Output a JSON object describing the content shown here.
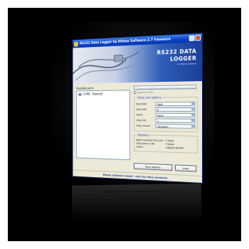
{
  "window": {
    "title": "RS232 Data Logger by Eltima Software 2.7 freeware"
  },
  "banner": {
    "line1": "RS232 DATA",
    "line2": "LOGGER",
    "sub": "by Eltima Software"
  },
  "ports": {
    "label": "Available ports",
    "items": [
      {
        "name": "COM1",
        "status": "[Started]"
      }
    ]
  },
  "log_file": {
    "path": "C:\\Program Files\\Eltima Software\\RS232 Data Logger\\COM1.log",
    "append_label": "Append to file"
  },
  "serial_options": {
    "title": "Serial port options",
    "rows": [
      {
        "label": "Baudrate",
        "value": "9600"
      },
      {
        "label": "Data bits",
        "value": "8"
      },
      {
        "label": "Parity",
        "value": "None"
      },
      {
        "label": "Stop bits",
        "value": "1"
      },
      {
        "label": "Flow control",
        "value": "Hardware"
      }
    ]
  },
  "statistics": {
    "title": "Statistics",
    "rows": [
      {
        "label": "Bytes received from port",
        "value": "0 bytes"
      },
      {
        "label": "Total bytes in file",
        "value": "0 bytes"
      },
      {
        "label": "Status",
        "value": "Logging started"
      }
    ]
  },
  "buttons": {
    "stop": "Stop logging",
    "help": "Help"
  },
  "footer": {
    "text": "Eltima Software GmbH - click for other products"
  },
  "colors": {
    "title_bar": "#0a3fc4",
    "banner_blue": "#2f5fb8",
    "background": "#000000",
    "window_face": "#ece9d8"
  }
}
